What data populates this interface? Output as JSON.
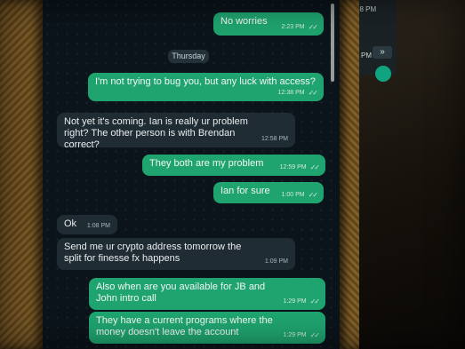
{
  "background_panel": {
    "time": "08 PM",
    "time2": "PM",
    "button_label": "»"
  },
  "date_separator": "Thursday",
  "messages": [
    {
      "direction": "out",
      "text": "No worries",
      "time": "2:23 PM"
    },
    {
      "direction": "out",
      "text": "I'm not trying to bug you, but any luck with access?",
      "time": "12:38 PM"
    },
    {
      "direction": "in",
      "text": "Not yet it's coming. Ian is really ur problem right? The other person is with Brendan correct?",
      "time": "12:58 PM"
    },
    {
      "direction": "out",
      "text": "They both are my problem",
      "time": "12:59 PM"
    },
    {
      "direction": "out",
      "text": "Ian for sure",
      "time": "1:00 PM"
    },
    {
      "direction": "in",
      "text": "Ok",
      "time": "1:08 PM"
    },
    {
      "direction": "in",
      "text": "Send me ur crypto address tomorrow the split for finesse fx happens",
      "time": "1:09 PM"
    },
    {
      "direction": "out",
      "text": "Also when are you available for JB and John intro call",
      "time": "1:29 PM"
    },
    {
      "direction": "out",
      "text": "They have a current programs where the money doesn't leave the account",
      "time": "1:29 PM"
    }
  ],
  "colors": {
    "outgoing_bubble": "#1fa46f",
    "incoming_bubble": "#202c33",
    "chat_background": "#0b141a"
  },
  "icons": {
    "read_receipt": "double-check-icon"
  }
}
